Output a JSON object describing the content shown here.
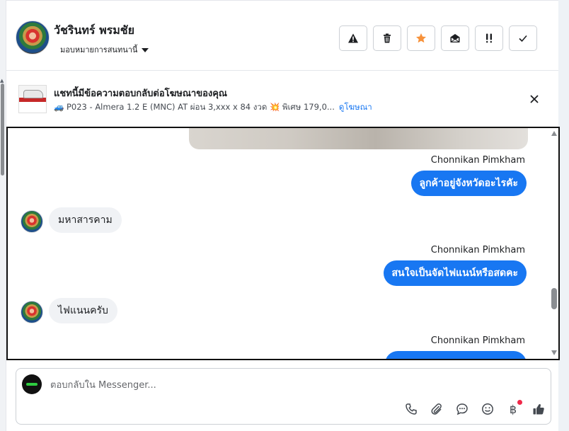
{
  "header": {
    "contact_name": "วัชรินทร์ พรมชัย",
    "assign_label": "มอบหมายการสนทนานี้",
    "toolbar": [
      {
        "name": "report",
        "icon": "warning-icon"
      },
      {
        "name": "delete",
        "icon": "trash-icon"
      },
      {
        "name": "star",
        "icon": "star-icon",
        "color": "#f7923b"
      },
      {
        "name": "mark-unread",
        "icon": "envelope-open-icon"
      },
      {
        "name": "follow-up",
        "icon": "double-exclamation-icon"
      },
      {
        "name": "done",
        "icon": "check-icon"
      }
    ]
  },
  "ad_banner": {
    "title": "แชทนี้มีข้อความตอบกลับต่อโฆษณาของคุณ",
    "description": "🚙 P023 - Almera 1.2 E (MNC) AT ผ่อน 3,xxx x 84 งวด 💥 พิเศษ 179,0...",
    "link_label": "ดูโฆษณา"
  },
  "messages": [
    {
      "direction": "out",
      "sender": "Chonnikan Pimkham",
      "text": "ลูกค้าอยู่จังหวัดอะไรคัะ"
    },
    {
      "direction": "in",
      "text": "มหาสารคาม"
    },
    {
      "direction": "out",
      "sender": "Chonnikan Pimkham",
      "text": "สนใจเป็นจัดไฟแนน์หรือสดคะ"
    },
    {
      "direction": "in",
      "text": "ไฟแนนครับ"
    },
    {
      "direction": "out",
      "sender": "Chonnikan Pimkham",
      "text": ""
    }
  ],
  "composer": {
    "placeholder": "ตอบกลับใน Messenger...",
    "value": "",
    "icons": [
      "phone-icon",
      "paperclip-icon",
      "chat-bubble-icon",
      "emoji-icon",
      "baht-icon",
      "thumbs-up-icon"
    ]
  },
  "colors": {
    "accent": "#1877f2",
    "star": "#f7923b",
    "incoming_bubble": "#f0f2f5",
    "notification": "#f02849"
  }
}
